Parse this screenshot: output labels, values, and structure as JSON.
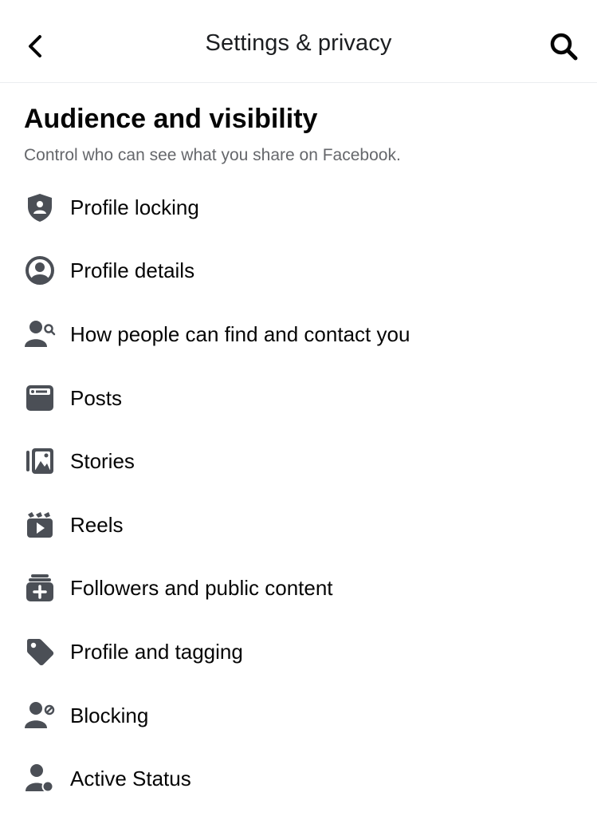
{
  "header": {
    "title": "Settings & privacy",
    "back_icon": "chevron-left-icon",
    "search_icon": "search-icon"
  },
  "section": {
    "title": "Audience and visibility",
    "subtitle": "Control who can see what you share on Facebook."
  },
  "items": [
    {
      "label": "Profile locking",
      "icon": "shield-user-icon"
    },
    {
      "label": "Profile details",
      "icon": "user-circle-icon"
    },
    {
      "label": "How people can find and contact you",
      "icon": "user-search-icon"
    },
    {
      "label": "Posts",
      "icon": "post-card-icon"
    },
    {
      "label": "Stories",
      "icon": "stories-icon"
    },
    {
      "label": "Reels",
      "icon": "reels-icon"
    },
    {
      "label": "Followers and public content",
      "icon": "followers-plus-icon"
    },
    {
      "label": "Profile and tagging",
      "icon": "tag-icon"
    },
    {
      "label": "Blocking",
      "icon": "user-block-icon"
    },
    {
      "label": "Active Status",
      "icon": "user-active-icon"
    }
  ],
  "colors": {
    "icon": "#4b4f56",
    "text": "#050505",
    "subtitle": "#65676b",
    "divider": "#ebedf0"
  }
}
